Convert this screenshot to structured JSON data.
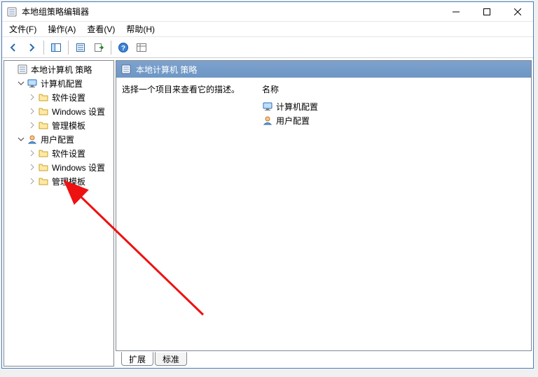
{
  "window": {
    "title": "本地组策略编辑器"
  },
  "menu": {
    "file": "文件(F)",
    "action": "操作(A)",
    "view": "查看(V)",
    "help": "帮助(H)"
  },
  "tree": {
    "root": "本地计算机 策略",
    "computer": "计算机配置",
    "computer_children": {
      "software": "软件设置",
      "windows": "Windows 设置",
      "templates": "管理模板"
    },
    "user": "用户配置",
    "user_children": {
      "software": "软件设置",
      "windows": "Windows 设置",
      "templates": "管理模板"
    }
  },
  "content": {
    "header": "本地计算机 策略",
    "description": "选择一个项目来查看它的描述。",
    "column_name": "名称",
    "items": {
      "computer": "计算机配置",
      "user": "用户配置"
    }
  },
  "tabs": {
    "extended": "扩展",
    "standard": "标准"
  }
}
